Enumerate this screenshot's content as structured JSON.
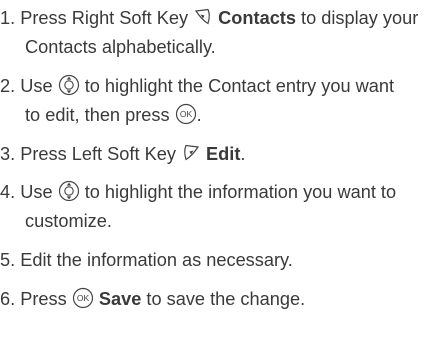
{
  "steps": [
    {
      "num": "1.",
      "pre": "Press Right Soft Key",
      "icon": "right-soft-key-icon",
      "bold": "Contacts",
      "post": "to display your",
      "line2": "Contacts alphabetically."
    },
    {
      "num": "2.",
      "pre": "Use",
      "icon": "navigation-key-icon",
      "post": "to highlight the Contact entry you want",
      "line2_pre": "to edit, then press",
      "line2_icon": "ok-key-icon",
      "line2_post": "."
    },
    {
      "num": "3.",
      "pre": "Press Left Soft Key",
      "icon": "left-soft-key-icon",
      "bold": "Edit",
      "post": "."
    },
    {
      "num": "4.",
      "pre": "Use",
      "icon": "navigation-key-icon",
      "post": "to highlight the information you want to",
      "line2": "customize."
    },
    {
      "num": "5.",
      "text": "Edit the information as necessary."
    },
    {
      "num": "6.",
      "pre": "Press",
      "icon": "ok-key-icon",
      "bold": "Save",
      "post": "to save the change."
    }
  ]
}
